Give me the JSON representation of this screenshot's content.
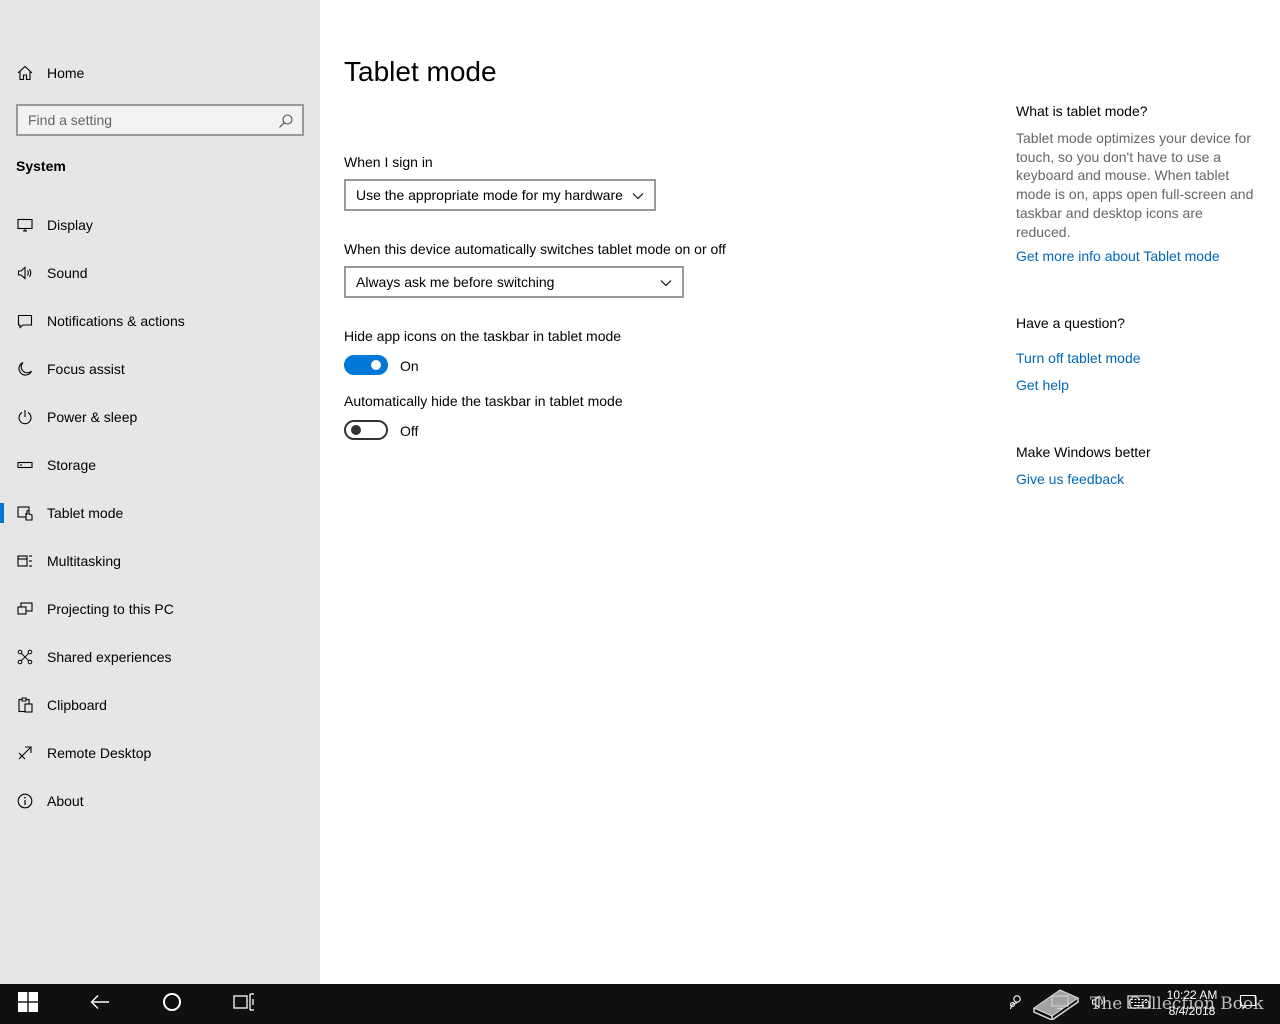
{
  "sidebar": {
    "home_label": "Home",
    "search_placeholder": "Find a setting",
    "section_title": "System",
    "items": [
      {
        "label": "Display",
        "icon": "display-icon"
      },
      {
        "label": "Sound",
        "icon": "sound-icon"
      },
      {
        "label": "Notifications & actions",
        "icon": "notifications-icon"
      },
      {
        "label": "Focus assist",
        "icon": "moon-icon"
      },
      {
        "label": "Power & sleep",
        "icon": "power-icon"
      },
      {
        "label": "Storage",
        "icon": "storage-icon"
      },
      {
        "label": "Tablet mode",
        "icon": "tablet-mode-icon",
        "selected": true
      },
      {
        "label": "Multitasking",
        "icon": "multitasking-icon"
      },
      {
        "label": "Projecting to this PC",
        "icon": "projecting-icon"
      },
      {
        "label": "Shared experiences",
        "icon": "shared-experiences-icon"
      },
      {
        "label": "Clipboard",
        "icon": "clipboard-icon"
      },
      {
        "label": "Remote Desktop",
        "icon": "remote-desktop-icon"
      },
      {
        "label": "About",
        "icon": "info-icon"
      }
    ]
  },
  "main": {
    "title": "Tablet mode",
    "sign_in_label": "When I sign in",
    "sign_in_value": "Use the appropriate mode for my hardware",
    "switch_label": "When this device automatically switches tablet mode on or off",
    "switch_value": "Always ask me before switching",
    "hide_icons_label": "Hide app icons on the taskbar in tablet mode",
    "hide_icons_state": "On",
    "auto_hide_label": "Automatically hide the taskbar in tablet mode",
    "auto_hide_state": "Off"
  },
  "right": {
    "what_heading": "What is tablet mode?",
    "what_text": "Tablet mode optimizes your device for touch, so you don't have to use a keyboard and mouse. When tablet mode is on, apps open full-screen and taskbar and desktop icons are reduced.",
    "more_info_link": "Get more info about Tablet mode",
    "question_heading": "Have a question?",
    "turn_off_link": "Turn off tablet mode",
    "help_link": "Get help",
    "better_heading": "Make Windows better",
    "feedback_link": "Give us feedback"
  },
  "taskbar": {
    "time": "10:22 AM",
    "date": "8/4/2018",
    "watermark": "The Collection Book"
  },
  "colors": {
    "accent": "#0078d7",
    "link": "#0067b8",
    "sidebar_bg": "#e6e6e6",
    "taskbar_bg": "#101010"
  }
}
